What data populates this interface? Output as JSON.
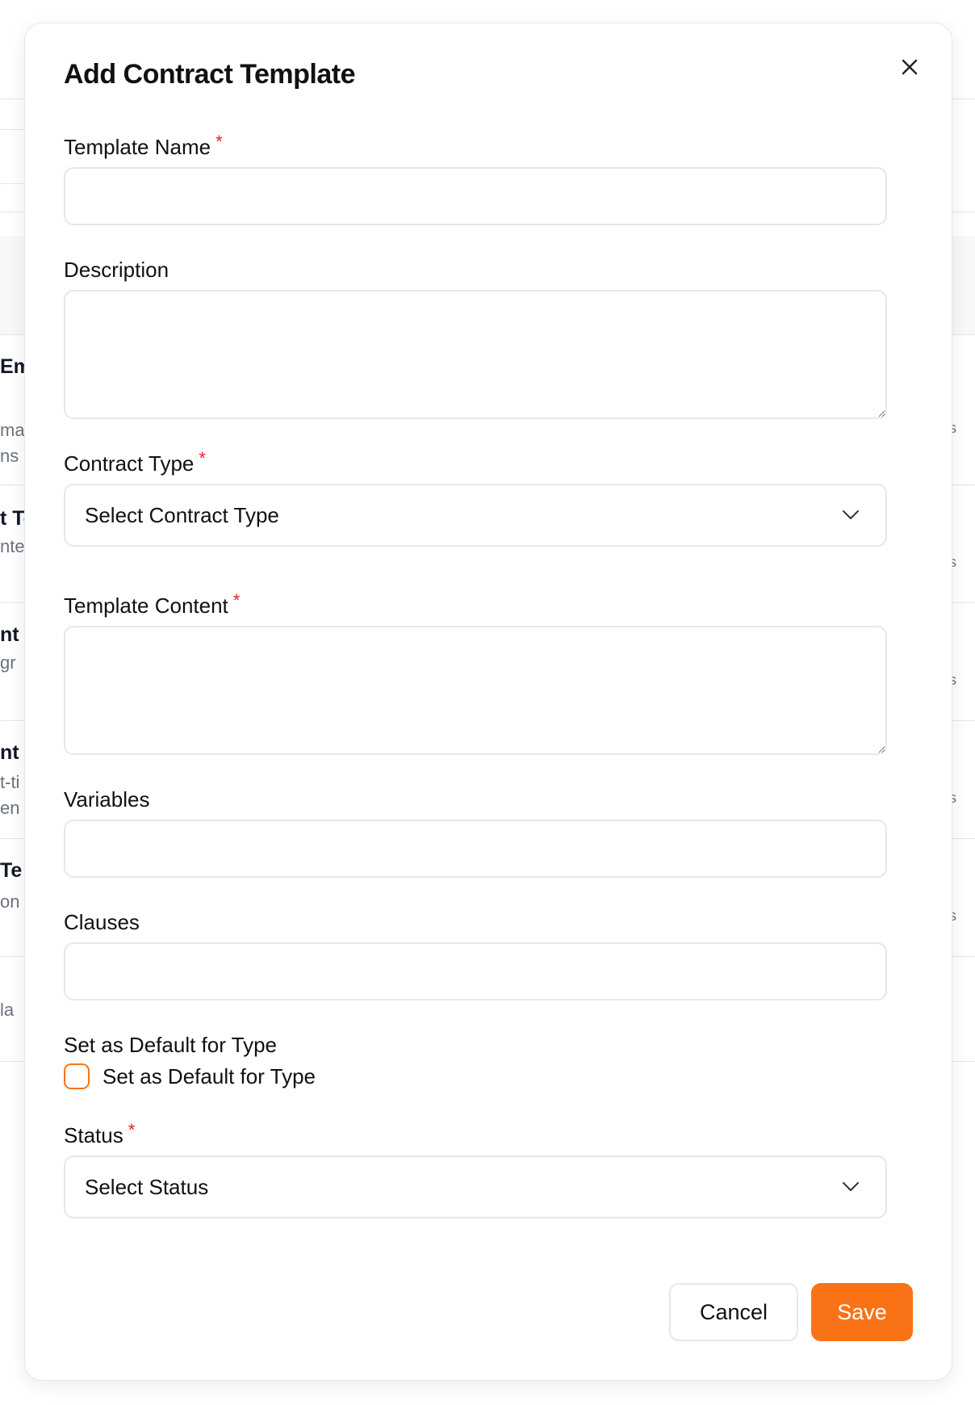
{
  "modal": {
    "title": "Add Contract Template",
    "required_mark": "*"
  },
  "form": {
    "template_name": {
      "label": "Template Name",
      "value": ""
    },
    "description": {
      "label": "Description",
      "value": ""
    },
    "contract_type": {
      "label": "Contract Type",
      "selected": "Select Contract Type"
    },
    "template_content": {
      "label": "Template Content",
      "value": ""
    },
    "variables": {
      "label": "Variables",
      "value": ""
    },
    "clauses": {
      "label": "Clauses",
      "value": ""
    },
    "default_for_type": {
      "label": "Set as Default for Type",
      "checkbox_label": "Set as Default for Type",
      "checked": false
    },
    "status": {
      "label": "Status",
      "selected": "Select Status"
    }
  },
  "actions": {
    "cancel_label": "Cancel",
    "save_label": "Save"
  },
  "colors": {
    "accent": "#f97316",
    "required": "#e11d2e",
    "border": "#e5e7eb"
  },
  "icons": {
    "close": "close-icon",
    "dropdown": "chevron-down-icon"
  },
  "background": {
    "fragments": [
      "Em",
      "ma",
      "ns",
      "t To",
      "nte",
      "nt T",
      "gr",
      "nt C",
      "t-ti",
      "en",
      "Te",
      "on",
      "la"
    ],
    "right_fragment": "s"
  }
}
